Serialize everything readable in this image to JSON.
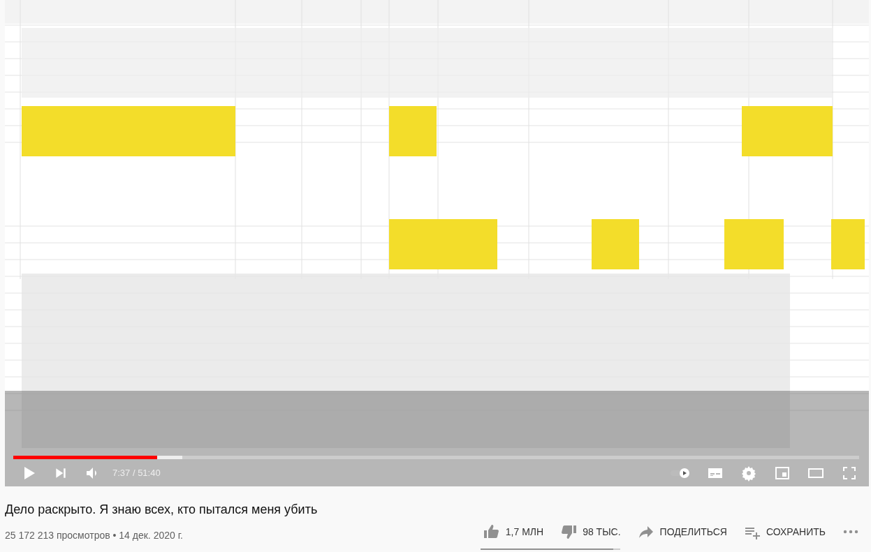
{
  "player": {
    "progress": {
      "level": 0.17
    },
    "buffered": {
      "level": 0.2
    },
    "time": "7:37 / 51:40",
    "autoplay": {
      "on": true
    }
  },
  "video": {
    "title": "Дело раскрыто. Я знаю всех, кто пытался меня убить",
    "meta": "25 172 213 просмотров • 14 дек. 2020 г."
  },
  "actions": {
    "likes": "1,7 МЛН",
    "dislikes": "98 ТЫС.",
    "share": "ПОДЕЛИТЬСЯ",
    "save": "СОХРАНИТЬ",
    "sentiment": {
      "level": 0.95
    }
  }
}
